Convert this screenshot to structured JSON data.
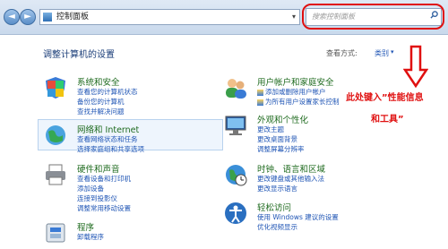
{
  "window": {
    "breadcrumb": "控制面板",
    "nav_back": "◄",
    "nav_forward": "►",
    "dropdown_glyph": "▾",
    "search_placeholder": "搜索控制面板",
    "search_icon": "search-icon"
  },
  "header": {
    "title": "调整计算机的设置",
    "view_by_label": "查看方式:",
    "view_by_value": "类别",
    "view_by_glyph": "▾"
  },
  "annotation": {
    "line1": "此处键入”性能信息",
    "line2": "和工具”",
    "color": "#e01010"
  },
  "categories": [
    {
      "title": "系统和安全",
      "icon": "shield-icon",
      "links": [
        "查看您的计算机状态",
        "备份您的计算机",
        "查找并解决问题"
      ]
    },
    {
      "title": "网络和 Internet",
      "icon": "network-globe-icon",
      "links": [
        "查看网络状态和任务",
        "选择家庭组和共享选项"
      ]
    },
    {
      "title": "硬件和声音",
      "icon": "printer-icon",
      "links": [
        "查看设备和打印机",
        "添加设备",
        "连接到投影仪",
        "调整常用移动设置"
      ]
    },
    {
      "title": "程序",
      "icon": "programs-icon",
      "links": [
        "卸载程序"
      ]
    },
    {
      "title": "用户帐户和家庭安全",
      "icon": "users-icon",
      "links": [
        "添加或删除用户帐户",
        "为所有用户设置家长控制"
      ]
    },
    {
      "title": "外观和个性化",
      "icon": "appearance-monitor-icon",
      "links": [
        "更改主题",
        "更改桌面背景",
        "调整屏幕分辨率"
      ]
    },
    {
      "title": "时钟、语言和区域",
      "icon": "clock-globe-icon",
      "links": [
        "更改键盘或其他输入法",
        "更改显示语言"
      ]
    },
    {
      "title": "轻松访问",
      "icon": "ease-of-access-icon",
      "links": [
        "使用 Windows 建议的设置",
        "优化视频显示"
      ]
    }
  ]
}
